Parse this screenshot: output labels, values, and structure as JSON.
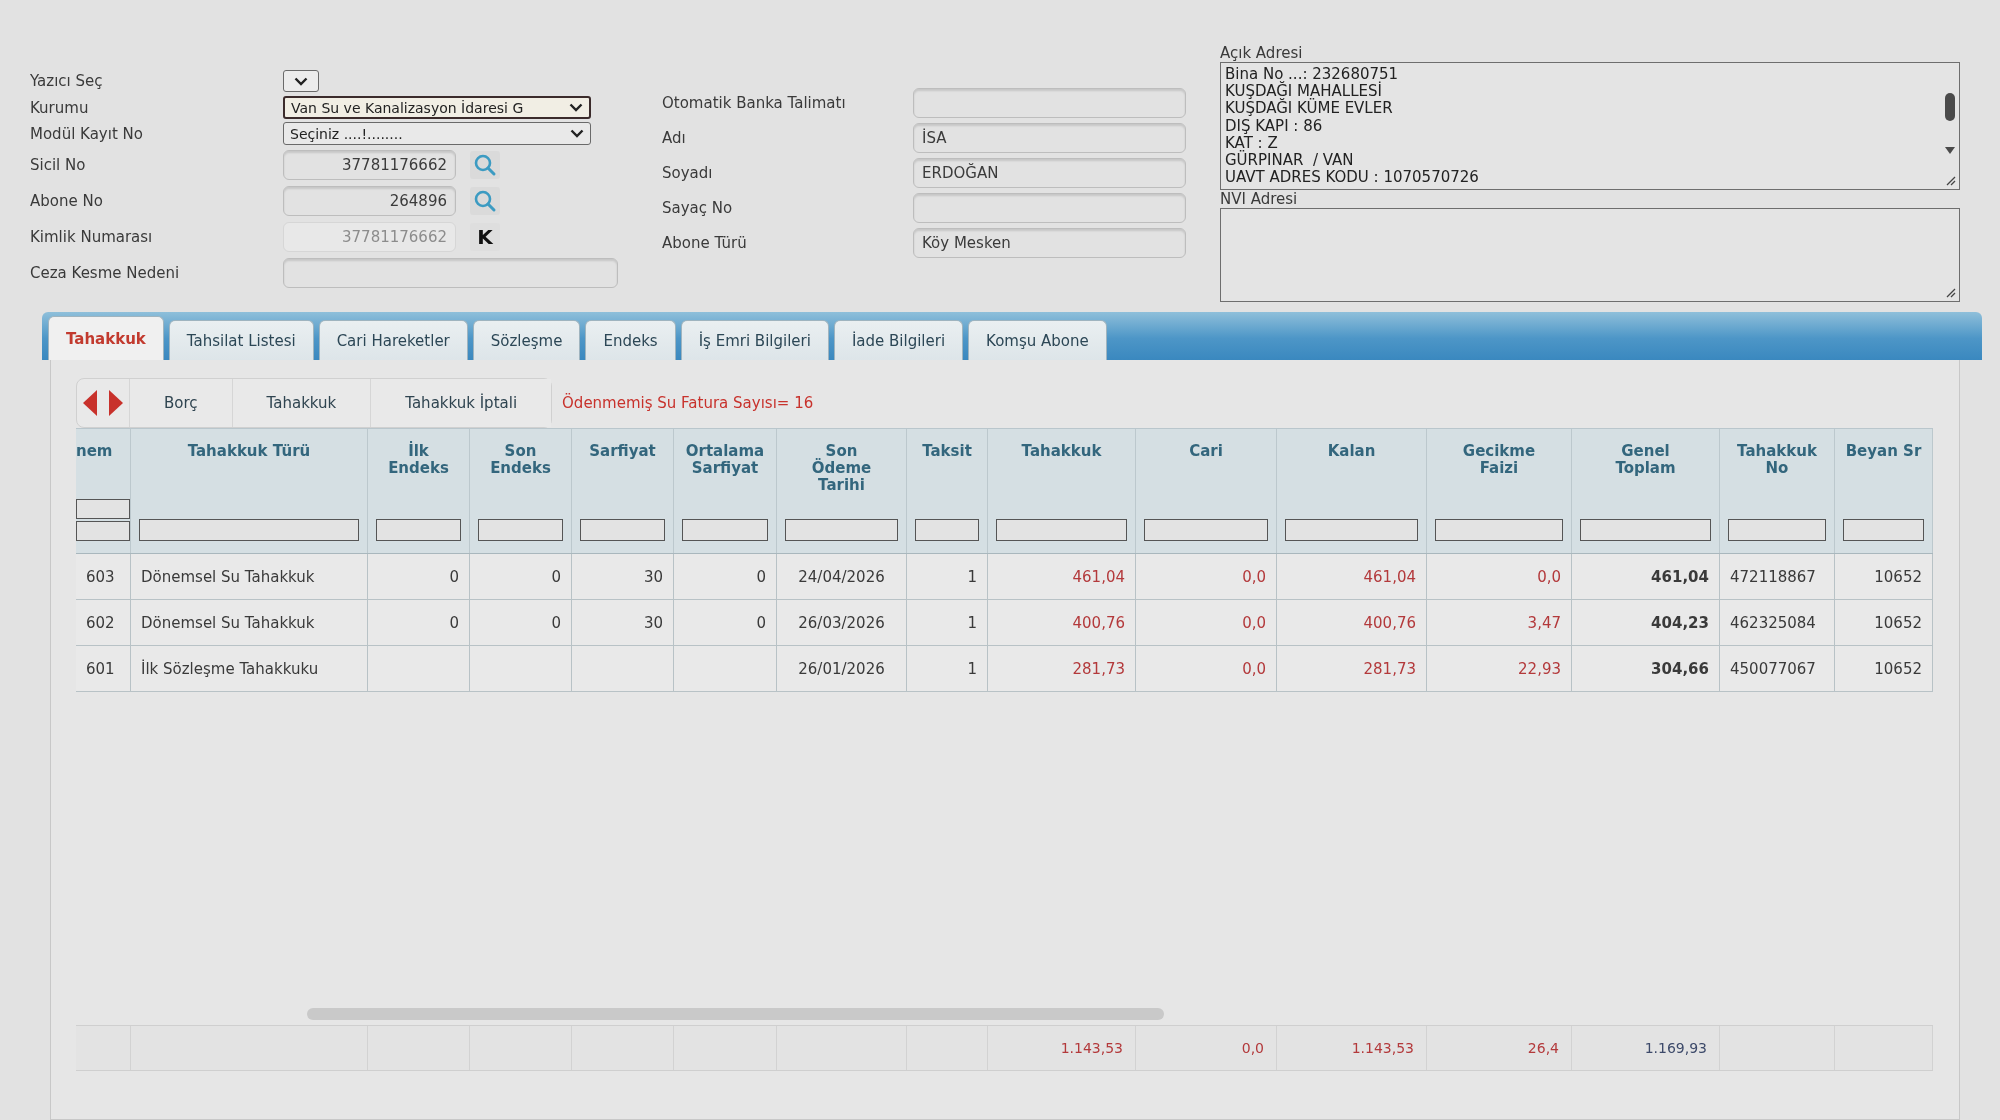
{
  "form_left": {
    "fields": [
      {
        "label": "Yazıcı Seç",
        "kind": "dropdown",
        "focused": false,
        "disabled": false
      },
      {
        "label": "Kurumu",
        "kind": "select",
        "value": "Van Su ve Kanalizasyon İdaresi G",
        "focused": true,
        "disabled": false
      },
      {
        "label": "Modül Kayıt No",
        "kind": "select",
        "value": "Seçiniz ....!........",
        "focused": false,
        "disabled": false
      },
      {
        "label": "Sicil No",
        "kind": "search",
        "value": "37781176662",
        "focused": false,
        "disabled": false
      },
      {
        "label": "Abone No",
        "kind": "search",
        "value": "264896",
        "focused": false,
        "disabled": false
      },
      {
        "label": "Kimlik Numarası",
        "kind": "letter",
        "value": "37781176662",
        "button_text": "K",
        "focused": false,
        "disabled": true
      },
      {
        "label": "Ceza Kesme Nedeni",
        "kind": "text",
        "focused": false,
        "disabled": false
      }
    ]
  },
  "form_middle": {
    "fields": [
      {
        "label": "Otomatik Banka Talimatı"
      },
      {
        "label": "Adı",
        "value": "İSA"
      },
      {
        "label": "Soyadı",
        "value": "ERDOĞAN"
      },
      {
        "label": "Sayaç No"
      },
      {
        "label": "Abone Türü",
        "value": "Köy Mesken"
      }
    ]
  },
  "address": {
    "label": "Açık Adresi",
    "lines": [
      "Bina No ...: 232680751",
      "KUŞDAĞI MAHALLESİ",
      "KUŞDAĞI KÜME EVLER",
      "DIŞ KAPI : 86",
      "KAT : Z",
      "GÜRPINAR  / VAN",
      "UAVT ADRES KODU : 1070570726"
    ]
  },
  "nvi_address": {
    "label": "NVI Adresi"
  },
  "tabs": [
    {
      "label": "Tahakkuk",
      "selected": true
    },
    {
      "label": "Tahsilat Listesi",
      "selected": false
    },
    {
      "label": "Cari Hareketler",
      "selected": false
    },
    {
      "label": "Sözleşme",
      "selected": false
    },
    {
      "label": "Endeks",
      "selected": false
    },
    {
      "label": "İş Emri Bilgileri",
      "selected": false
    },
    {
      "label": "İade Bilgileri",
      "selected": false
    },
    {
      "label": "Komşu Abone",
      "selected": false
    }
  ],
  "toolbar": {
    "buttons": [
      "Borç",
      "Tahakkuk",
      "Tahakkuk İptali"
    ],
    "notice": "Ödenmemiş Su Fatura Sayısı= 16"
  },
  "table": {
    "columns": [
      {
        "label": "nem"
      },
      {
        "label": "Tahakkuk Türü"
      },
      {
        "label": "İlk\nEndeks"
      },
      {
        "label": "Son\nEndeks"
      },
      {
        "label": "Sarfiyat"
      },
      {
        "label": "Ortalama\nSarfiyat"
      },
      {
        "label": "Son\nÖdeme\nTarihi"
      },
      {
        "label": "Taksit"
      },
      {
        "label": "Tahakkuk"
      },
      {
        "label": "Cari"
      },
      {
        "label": "Kalan"
      },
      {
        "label": "Gecikme\nFaizi"
      },
      {
        "label": "Genel\nToplam"
      },
      {
        "label": "Tahakkuk\nNo"
      },
      {
        "label": "Beyan Sr"
      }
    ],
    "rows": [
      {
        "period": "603",
        "type": "Dönemsel Su Tahakkuk",
        "first_index": "0",
        "last_index": "0",
        "consumption": "30",
        "avg_consumption": "0",
        "due_date": "24/04/2026",
        "installment": "1",
        "accrual": "461,04",
        "current": "0,0",
        "remaining": "461,04",
        "late_interest": "0,0",
        "total": "461,04",
        "accrual_no": "472118867",
        "declaration_no": "10652"
      },
      {
        "period": "602",
        "type": "Dönemsel Su Tahakkuk",
        "first_index": "0",
        "last_index": "0",
        "consumption": "30",
        "avg_consumption": "0",
        "due_date": "26/03/2026",
        "installment": "1",
        "accrual": "400,76",
        "current": "0,0",
        "remaining": "400,76",
        "late_interest": "3,47",
        "total": "404,23",
        "accrual_no": "462325084",
        "declaration_no": "10652"
      },
      {
        "period": "601",
        "type": "İlk Sözleşme Tahakkuku",
        "due_date": "26/01/2026",
        "installment": "1",
        "accrual": "281,73",
        "current": "0,0",
        "remaining": "281,73",
        "late_interest": "22,93",
        "total": "304,66",
        "accrual_no": "450077067",
        "declaration_no": "10652"
      }
    ],
    "totals": {
      "accrual": "1.143,53",
      "current": "0,0",
      "remaining": "1.143,53",
      "late_interest": "26,4",
      "total": "1.169,93"
    }
  }
}
